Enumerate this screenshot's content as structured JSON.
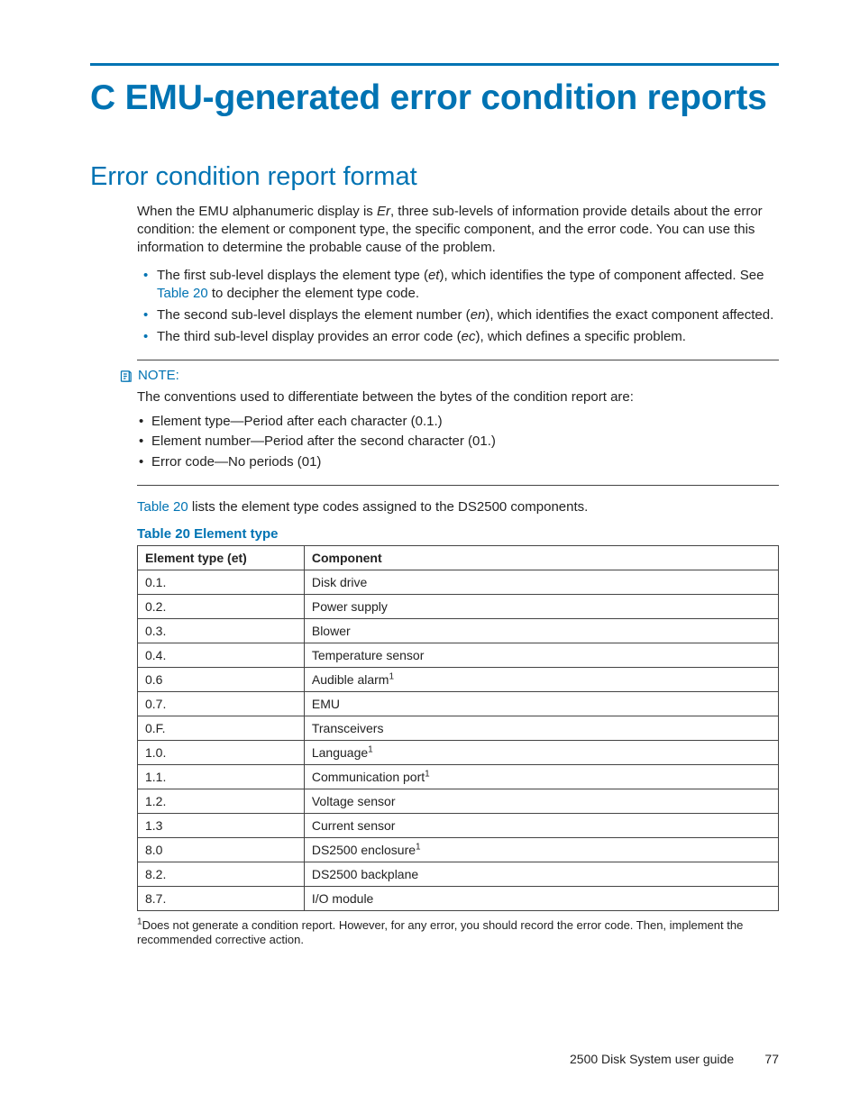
{
  "title": "C EMU-generated error condition reports",
  "section_title": "Error condition report format",
  "intro_parts": {
    "a": "When the EMU alphanumeric display is ",
    "er": "Er",
    "b": ", three sub-levels of information provide details about the error condition:  the element or component type, the specific component, and the error code.  You can use this information to determine the probable cause of the problem."
  },
  "bullets": [
    {
      "pre": "The first sub-level displays the element type (",
      "it": "et",
      "mid": "), which identifies the type of component affected.  See ",
      "link": "Table 20",
      "post": " to decipher the element type code."
    },
    {
      "pre": "The second sub-level displays the element number (",
      "it": "en",
      "mid": "), which identifies the exact component affected.",
      "link": "",
      "post": ""
    },
    {
      "pre": "The third sub-level display provides an error code (",
      "it": "ec",
      "mid": "), which defines a specific problem.",
      "link": "",
      "post": ""
    }
  ],
  "note": {
    "label": "NOTE:",
    "lead": "The conventions used to differentiate between the bytes of the condition report are:",
    "items": [
      "Element type—Period after each character (0.1.)",
      "Element number—Period after the second character (01.)",
      "Error code—No periods (01)"
    ]
  },
  "after_note": {
    "link": "Table 20",
    "rest": " lists the element type codes assigned to the DS2500 components."
  },
  "table": {
    "caption": "Table 20 Element type",
    "headers": [
      "Element type (et)",
      "Component"
    ],
    "rows": [
      {
        "a": "0.1.",
        "b": "Disk drive",
        "sup": ""
      },
      {
        "a": "0.2.",
        "b": "Power supply",
        "sup": ""
      },
      {
        "a": "0.3.",
        "b": "Blower",
        "sup": ""
      },
      {
        "a": "0.4.",
        "b": "Temperature sensor",
        "sup": ""
      },
      {
        "a": "0.6",
        "b": "Audible alarm",
        "sup": "1"
      },
      {
        "a": "0.7.",
        "b": "EMU",
        "sup": ""
      },
      {
        "a": "0.F.",
        "b": "Transceivers",
        "sup": ""
      },
      {
        "a": "1.0.",
        "b": "Language",
        "sup": "1"
      },
      {
        "a": "1.1.",
        "b": "Communication port",
        "sup": "1"
      },
      {
        "a": "1.2.",
        "b": "Voltage sensor",
        "sup": ""
      },
      {
        "a": "1.3",
        "b": "Current sensor",
        "sup": ""
      },
      {
        "a": "8.0",
        "b": "DS2500 enclosure",
        "sup": "1"
      },
      {
        "a": "8.2.",
        "b": "DS2500 backplane",
        "sup": ""
      },
      {
        "a": "8.7.",
        "b": "I/O module",
        "sup": ""
      }
    ]
  },
  "footnote": {
    "marker": "1",
    "text": "Does not generate a condition report.  However, for any error, you should record the error code.  Then, implement the recommended corrective action."
  },
  "footer": {
    "guide": "2500 Disk System user guide",
    "page": "77"
  }
}
